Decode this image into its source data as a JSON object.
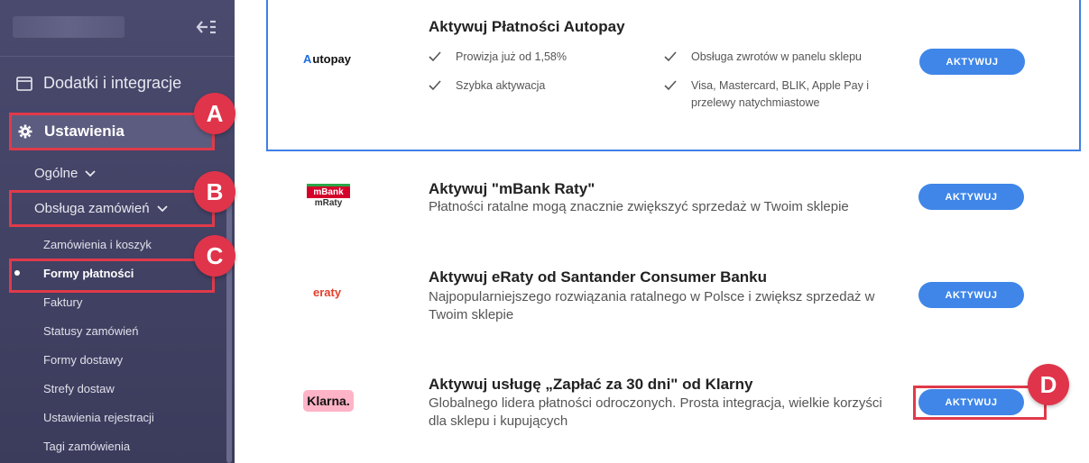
{
  "sidebar": {
    "dodatki_label": "Dodatki i integracje",
    "ustawienia_label": "Ustawienia",
    "ogolne_label": "Ogólne",
    "obsluga_label": "Obsługa zamówień",
    "leaves": [
      "Zamówienia i koszyk",
      "Formy płatności",
      "Faktury",
      "Statusy zamówień",
      "Formy dostawy",
      "Strefy dostaw",
      "Ustawienia rejestracji",
      "Tagi zamówienia"
    ]
  },
  "markers": {
    "a": "A",
    "b": "B",
    "c": "C",
    "d": "D"
  },
  "autopay": {
    "logo_mark": "A",
    "logo_text": "utopay",
    "title": "Aktywuj Płatności Autopay",
    "features": [
      "Prowizja już od 1,58%",
      "Obsługa zwrotów w panelu sklepu",
      "Szybka aktywacja",
      "Visa, Mastercard, BLIK, Apple Pay i przelewy natychmiastowe"
    ],
    "button": "AKTYWUJ"
  },
  "mbank": {
    "logo_top": "mBank",
    "logo_bottom": "mRaty",
    "title": "Aktywuj \"mBank Raty\"",
    "desc": "Płatności ratalne mogą znacznie zwiększyć sprzedaż w Twoim sklepie",
    "button": "AKTYWUJ"
  },
  "eraty": {
    "logo_text": "eraty",
    "title": "Aktywuj eRaty od Santander Consumer Banku",
    "desc": "Najpopularniejszego rozwiązania ratalnego w Polsce i zwiększ sprzedaż w Twoim sklepie",
    "button": "AKTYWUJ"
  },
  "klarna": {
    "logo_text": "Klarna.",
    "title": "Aktywuj usługę „Zapłać za 30 dni\" od Klarny",
    "desc": "Globalnego lidera płatności odroczonych. Prosta integracja, wielkie korzyści dla sklepu i kupujących",
    "button": "AKTYWUJ"
  },
  "colors": {
    "accent": "#3f86e8",
    "highlight": "#e03a4a",
    "sidebar_bg": "#45456a"
  }
}
